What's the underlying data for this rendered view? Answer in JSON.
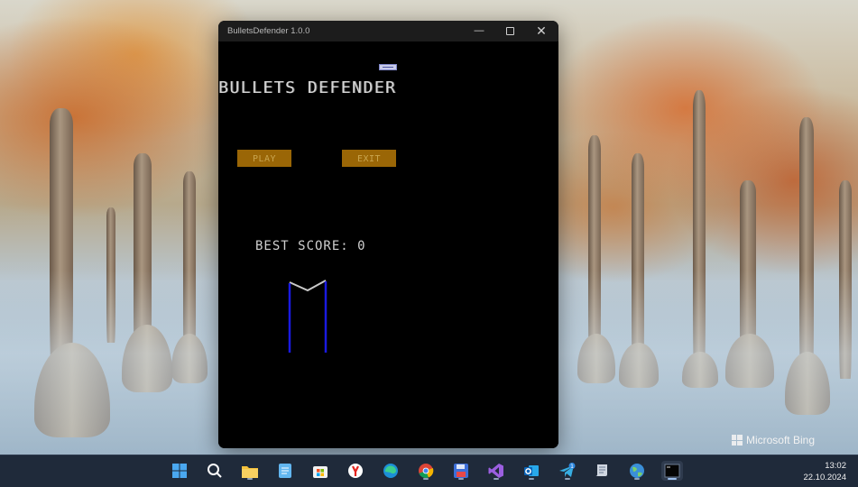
{
  "window": {
    "title": "BulletsDefender 1.0.0",
    "controls": {
      "minimize": "—",
      "close": "✕"
    }
  },
  "game": {
    "title": "BULLETS DEFENDER",
    "play_label": "PLAY",
    "exit_label": "EXIT",
    "best_score_label": "BEST SCORE: 0"
  },
  "colors": {
    "button_bg": "#9a6606",
    "button_text": "#c9a54f",
    "paddle": "#c8cbe9",
    "defender_walls": "#1a1ae0"
  },
  "desktop": {
    "watermark": "Microsoft Bing"
  },
  "taskbar": {
    "apps": [
      {
        "name": "start-icon",
        "glyph": "⊞"
      },
      {
        "name": "search-icon",
        "glyph": "⌕"
      },
      {
        "name": "file-explorer-icon",
        "glyph": ""
      },
      {
        "name": "notepad-icon",
        "glyph": ""
      },
      {
        "name": "microsoft-store-icon",
        "glyph": ""
      },
      {
        "name": "yandex-browser-icon",
        "glyph": "Y"
      },
      {
        "name": "edge-icon",
        "glyph": ""
      },
      {
        "name": "chrome-icon",
        "glyph": ""
      },
      {
        "name": "floppy-save-icon",
        "glyph": ""
      },
      {
        "name": "visual-studio-icon",
        "glyph": ""
      },
      {
        "name": "outlook-icon",
        "glyph": "O"
      },
      {
        "name": "telegram-icon",
        "glyph": "1"
      },
      {
        "name": "script-scroll-icon",
        "glyph": ""
      },
      {
        "name": "globe-app-icon",
        "glyph": ""
      },
      {
        "name": "terminal-icon",
        "glyph": "_"
      }
    ],
    "time": "13:02",
    "date": "22.10.2024"
  }
}
